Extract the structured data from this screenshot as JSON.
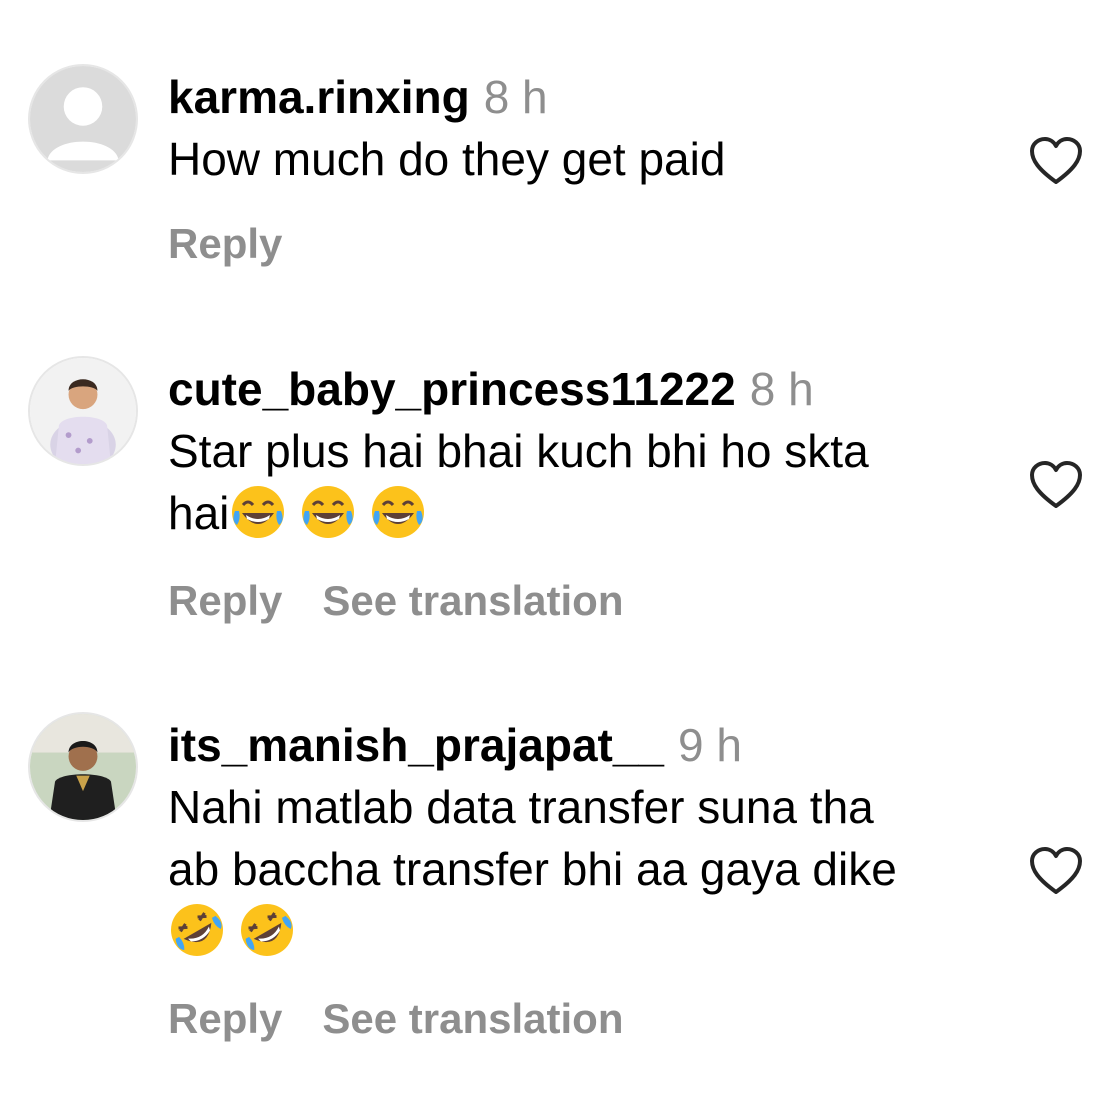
{
  "comments": [
    {
      "username": "karma.rinxing",
      "time": "8 h",
      "text_lines": [
        "How much do they get paid"
      ],
      "emojis": [],
      "reply_label": "Reply",
      "translation_label": "",
      "avatar": "default-avatar-icon"
    },
    {
      "username": "cute_baby_princess11222",
      "time": "8 h",
      "text_lines": [
        "Star plus hai bhai kuch bhi ho skta",
        "hai"
      ],
      "emojis": [
        "tears-of-joy",
        "tears-of-joy",
        "tears-of-joy"
      ],
      "reply_label": "Reply",
      "translation_label": "See translation",
      "avatar": "child-photo-avatar"
    },
    {
      "username": "its_manish_prajapat__",
      "time": "9 h",
      "text_lines": [
        "Nahi matlab data transfer suna tha",
        "ab baccha transfer bhi aa gaya dike"
      ],
      "emojis": [
        "rolling-on-floor-laughing",
        "rolling-on-floor-laughing"
      ],
      "reply_label": "Reply",
      "translation_label": "See translation",
      "avatar": "man-photo-avatar"
    }
  ],
  "colors": {
    "secondary_text": "#8e8e8e",
    "primary_text": "#000000",
    "background": "#ffffff"
  }
}
